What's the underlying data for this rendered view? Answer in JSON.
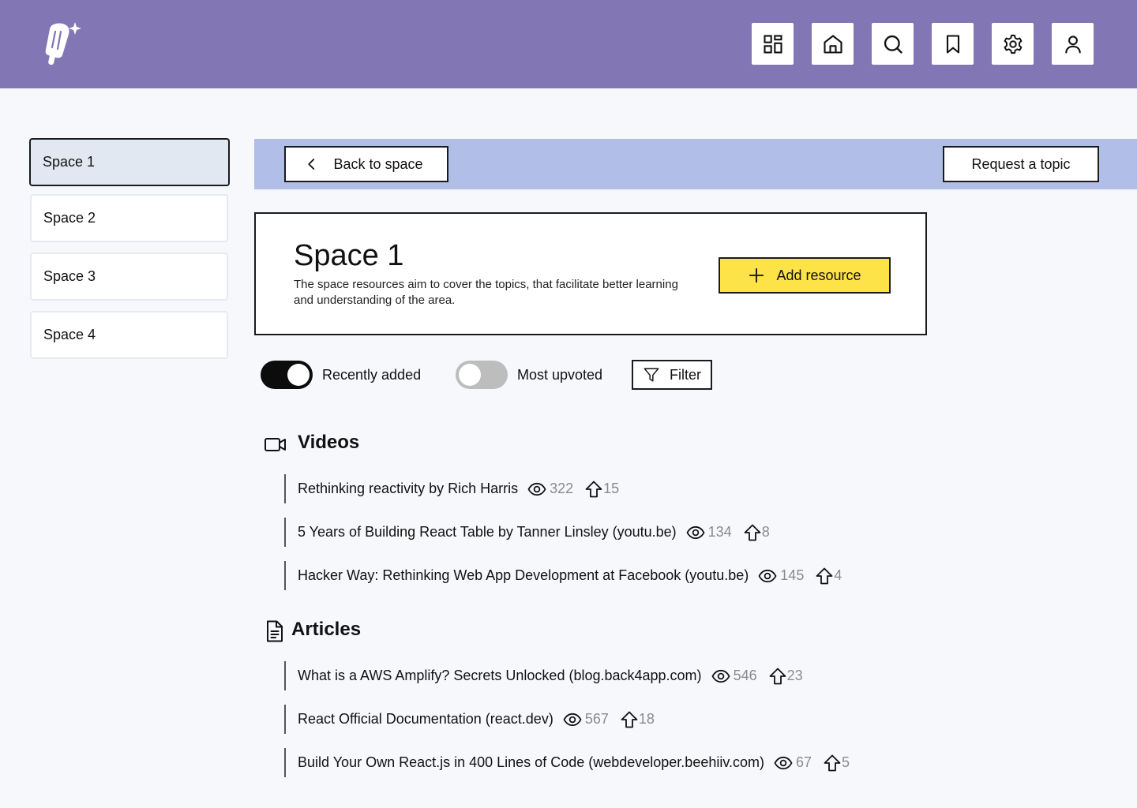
{
  "header": {
    "logo_icon": "popsicle-sparkle-logo",
    "nav_icons": [
      "dashboard-icon",
      "home-icon",
      "search-icon",
      "bookmark-icon",
      "settings-icon",
      "user-icon"
    ],
    "colors": {
      "header_bg": "#8276b4",
      "subbar_bg": "#b1bfe8",
      "accent_yellow": "#fde248"
    }
  },
  "sidebar": {
    "items": [
      {
        "label": "Space 1",
        "active": true
      },
      {
        "label": "Space 2",
        "active": false
      },
      {
        "label": "Space 3",
        "active": false
      },
      {
        "label": "Space 4",
        "active": false
      }
    ]
  },
  "subbar": {
    "back_label": "Back to space",
    "request_label": "Request a topic"
  },
  "space": {
    "title": "Space 1",
    "description": "The space resources aim to cover the topics, that facilitate better learning and understanding of the area.",
    "add_label": "Add resource"
  },
  "filters": {
    "recently_added": {
      "label": "Recently added",
      "on": true
    },
    "most_upvoted": {
      "label": "Most upvoted",
      "on": false
    },
    "filter_label": "Filter"
  },
  "sections": {
    "videos": {
      "title": "Videos",
      "items": [
        {
          "title": "Rethinking reactivity by Rich Harris",
          "views": "322",
          "upvotes": "15"
        },
        {
          "title": "5 Years of Building React Table by Tanner Linsley (youtu.be)",
          "views": "134",
          "upvotes": "8"
        },
        {
          "title": "Hacker Way: Rethinking Web App Development at Facebook (youtu.be)",
          "views": "145",
          "upvotes": "4"
        }
      ]
    },
    "articles": {
      "title": "Articles",
      "items": [
        {
          "title": "What is a AWS Amplify? Secrets Unlocked (blog.back4app.com)",
          "views": "546",
          "upvotes": "23"
        },
        {
          "title": "React Official Documentation (react.dev)",
          "views": "567",
          "upvotes": "18"
        },
        {
          "title": "Build Your Own React.js in 400 Lines of Code (webdeveloper.beehiiv.com)",
          "views": "67",
          "upvotes": "5"
        }
      ]
    }
  }
}
